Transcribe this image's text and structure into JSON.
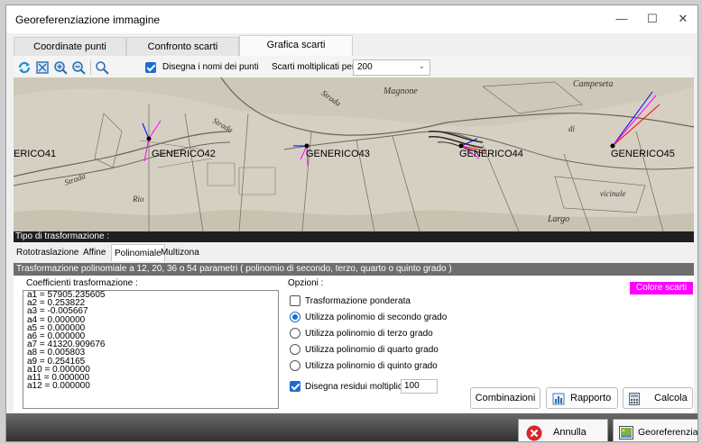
{
  "window": {
    "title": "Georeferenziazione immagine",
    "minimize_glyph": "—",
    "maximize_glyph": "☐",
    "close_glyph": "✕"
  },
  "main_tabs": [
    {
      "label": "Coordinate punti",
      "active": false
    },
    {
      "label": "Confronto scarti",
      "active": false
    },
    {
      "label": "Grafica scarti",
      "active": true
    }
  ],
  "toolbar": {
    "icons": [
      "refresh-icon",
      "zoom-extent-icon",
      "zoom-in-icon",
      "zoom-out-icon",
      "zoom-window-icon"
    ],
    "draw_names_label": "Disegna i nomi dei punti",
    "draw_names_checked": true,
    "multiplier_label": "Scarti moltiplicati per",
    "multiplier_value": "200"
  },
  "map": {
    "points": [
      {
        "name": "ERICO41"
      },
      {
        "name": "GENERICO42"
      },
      {
        "name": "GENERICO43"
      },
      {
        "name": "GENERICO44"
      },
      {
        "name": "GENERICO45"
      }
    ],
    "map_labels": [
      "Magnone",
      "Campeseta",
      "Strada",
      "Strada",
      "Strada",
      "vicinale",
      "Largo",
      "Rio",
      "di"
    ]
  },
  "transform": {
    "header": "Tipo di trasformazione :",
    "tabs": [
      "Rototraslazione",
      "Affine",
      "Polinomiale",
      "Multizona"
    ],
    "active_tab": "Polinomiale",
    "description": "Trasformazione polinomiale a 12, 20, 36 o 54 parametri ( polinomio di secondo, terzo, quarto o quinto grado )",
    "coefficients_label": "Coefficienti trasformazione :",
    "coefficients": [
      "a1 = 57905.235605",
      "a2 = 0.253822",
      "a3 = -0.005667",
      "a4 = 0.000000",
      "a5 = 0.000000",
      "a6 = 0.000000",
      "a7 = 41320.909676",
      "a8 = 0.005803",
      "a9 = 0.254165",
      "a10 = 0.000000",
      "a11 = 0.000000",
      "a12 = 0.000000"
    ],
    "options_label": "Opzioni :",
    "weighted_label": "Trasformazione ponderata",
    "weighted_checked": false,
    "degree_options": [
      {
        "label": "Utilizza polinomio di secondo grado",
        "selected": true
      },
      {
        "label": "Utilizza polinomio di terzo grado",
        "selected": false
      },
      {
        "label": "Utilizza polinomio di quarto grado",
        "selected": false
      },
      {
        "label": "Utilizza polinomio di quinto grado",
        "selected": false
      }
    ],
    "residuals_label": "Disegna residui moltiplicati x",
    "residuals_checked": true,
    "residuals_value": "100",
    "color_button": "Colore scarti",
    "color_value": "#ff00ff",
    "combinations_button": "Combinazioni",
    "report_button": "Rapporto",
    "calculate_button": "Calcola"
  },
  "footer": {
    "cancel_button": "Annulla",
    "georeference_button": "Georeferenzia"
  }
}
